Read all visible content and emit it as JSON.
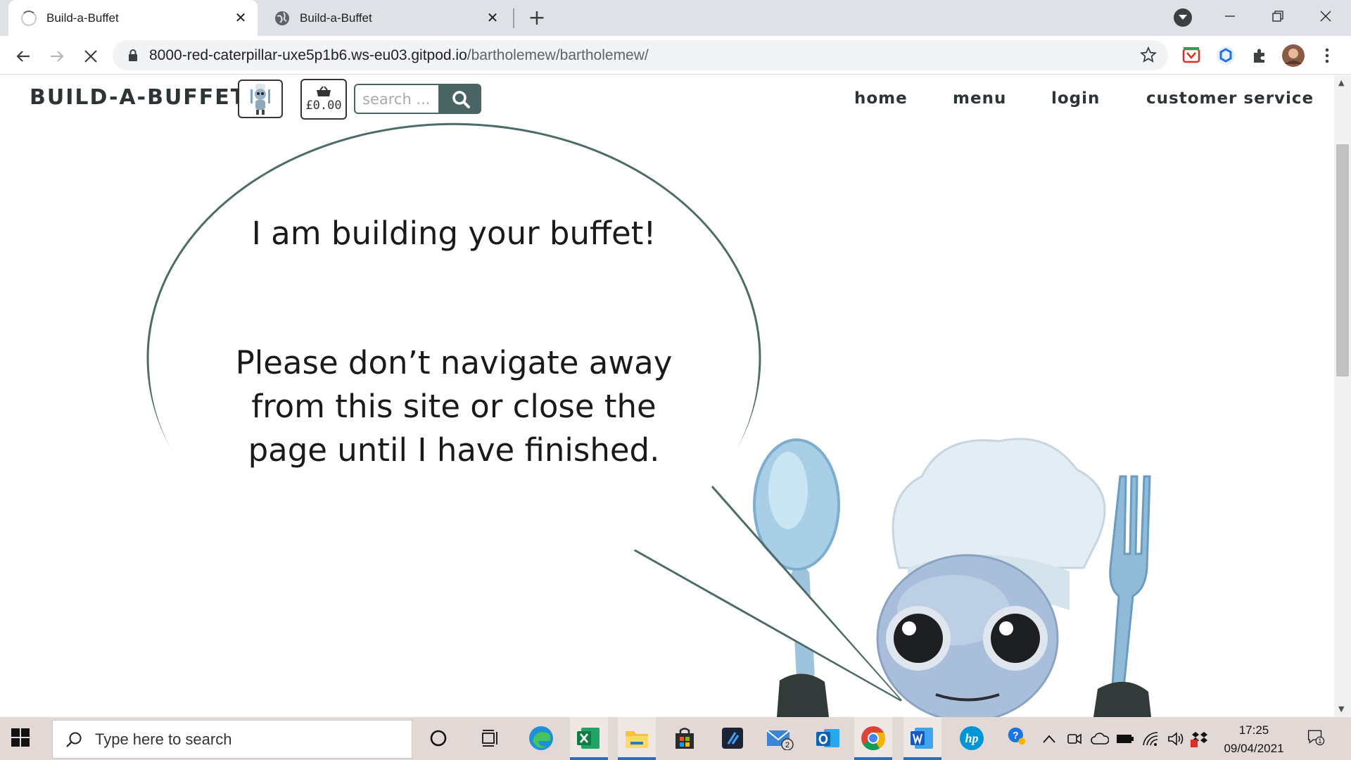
{
  "browser": {
    "tabs": [
      {
        "title": "Build-a-Buffet",
        "loading": true
      },
      {
        "title": "Build-a-Buffet",
        "loading": false
      }
    ],
    "url_host": "8000-red-caterpillar-uxe5p1b6.ws-eu03.gitpod.io",
    "url_path": "/bartholemew/bartholemew/"
  },
  "site": {
    "brand": "BUILD-A-BUFFET",
    "basket_total": "£0.00",
    "search_placeholder": "search ...",
    "nav": [
      "home",
      "menu",
      "login",
      "customer service"
    ],
    "bubble_line1": "I am building your buffet!",
    "bubble_line2": "Please don’t navigate away from this site or close the page until I have finished."
  },
  "taskbar": {
    "search_placeholder": "Type here to search",
    "time": "17:25",
    "date": "09/04/2021",
    "mail_badge": "2",
    "notification_badge": "1"
  },
  "colors": {
    "accent": "#4b6464",
    "bubble_outline": "#4d6b68"
  }
}
